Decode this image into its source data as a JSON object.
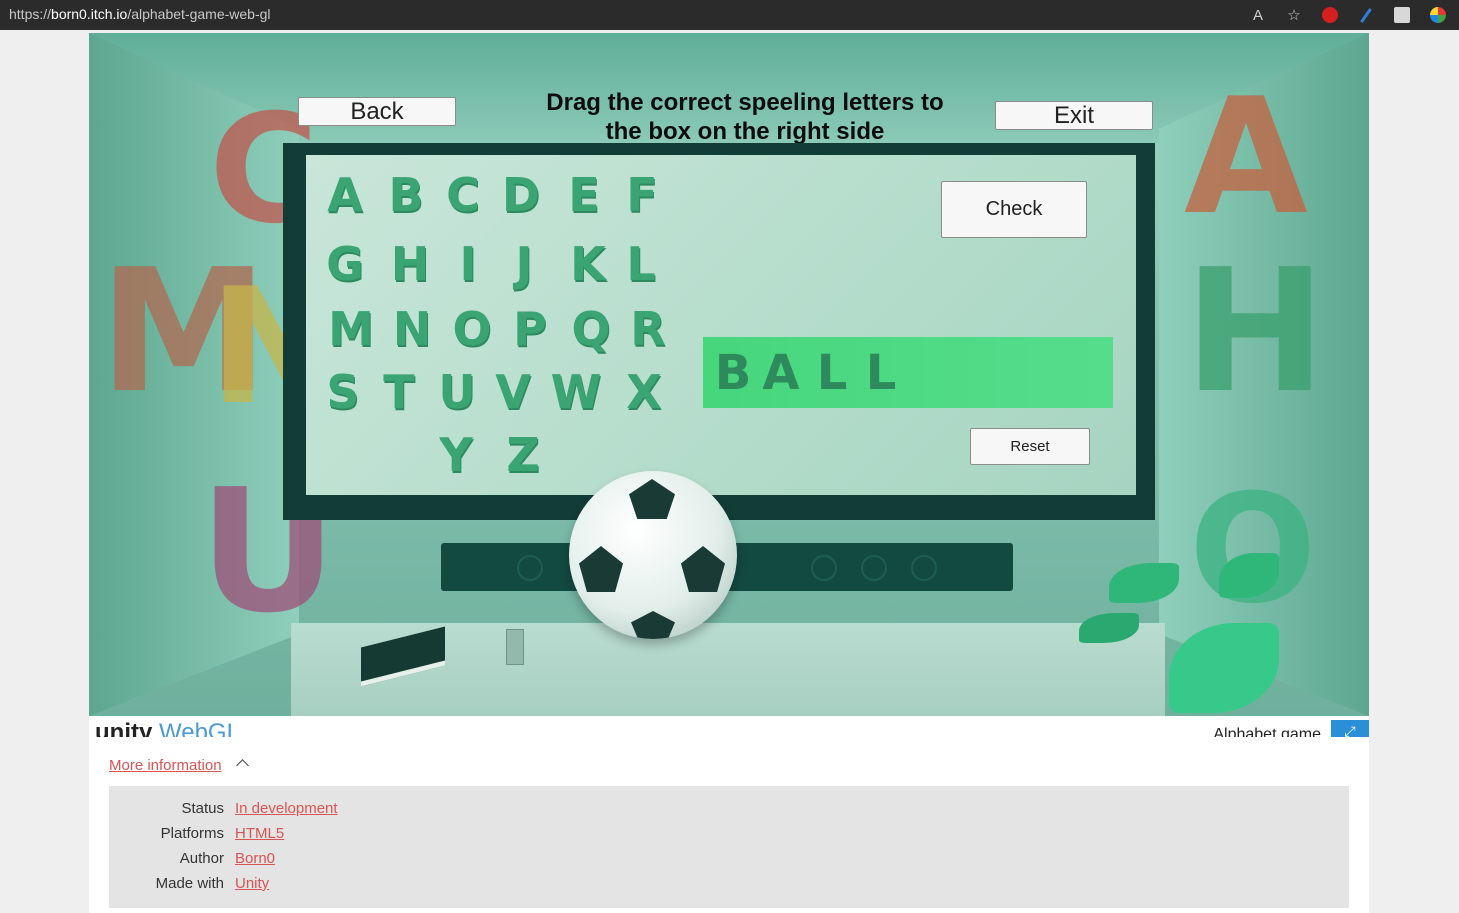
{
  "browser": {
    "url_prefix": "https://",
    "url_host": "born0.itch.io",
    "url_path": "/alphabet-game-web-gl",
    "read_aloud_icon": "A",
    "favorites_icon": "☆"
  },
  "game": {
    "instruction": "Drag the correct speeling letters to the box on the right side",
    "back_label": "Back",
    "exit_label": "Exit",
    "check_label": "Check",
    "reset_label": "Reset",
    "letters": [
      "A",
      "B",
      "C",
      "D",
      "E",
      "F",
      "G",
      "H",
      "I",
      "J",
      "K",
      "L",
      "M",
      "N",
      "O",
      "P",
      "Q",
      "R",
      "S",
      "T",
      "U",
      "V",
      "W",
      "X",
      "Y",
      "Z"
    ],
    "answer": [
      "B",
      "A",
      "L",
      "L"
    ]
  },
  "unity_bar": {
    "logo_text": "unity",
    "logo_suffix": "WebGL",
    "game_name": "Alphabet game",
    "fullscreen_icon": "⤢"
  },
  "info": {
    "toggle_label": "More information",
    "rows": [
      {
        "label": "Status",
        "value": "In development"
      },
      {
        "label": "Platforms",
        "value": "HTML5"
      },
      {
        "label": "Author",
        "value": "Born0"
      },
      {
        "label": "Made with",
        "value": "Unity"
      }
    ]
  },
  "colors": {
    "link": "#da5454",
    "letter_green": "#3aa473",
    "answer_box": "#46d67c"
  }
}
